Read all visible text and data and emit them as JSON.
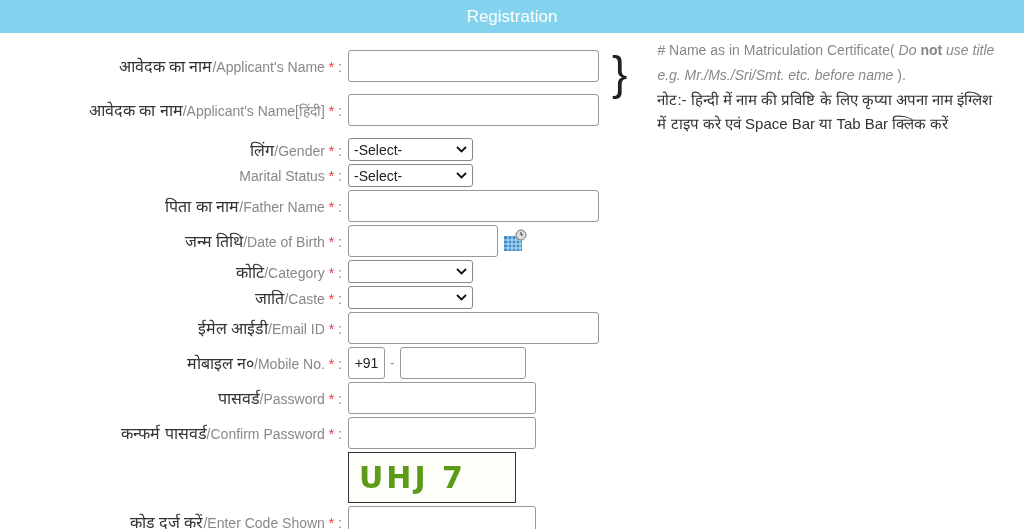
{
  "header": {
    "title": "Registration"
  },
  "fields": [
    {
      "kind": "name",
      "hindi": "आवेदक का नाम",
      "english": "/Applicant's Name",
      "asterisk": "*",
      "colon": ":"
    },
    {
      "kind": "name",
      "hindi": "आवेदक का नाम",
      "english": "/Applicant's Name[हिंदी]",
      "asterisk": "*",
      "colon": ":"
    },
    {
      "kind": "select",
      "hindi": "लिंग",
      "english": "/Gender",
      "asterisk": "*",
      "colon": ":",
      "value": "-Select-"
    },
    {
      "kind": "select",
      "english": "Marital Status",
      "asterisk": "*",
      "colon": ":",
      "value": "-Select-"
    },
    {
      "kind": "text",
      "hindi": "पिता का नाम",
      "english": "/Father Name",
      "asterisk": "*",
      "colon": ":"
    },
    {
      "kind": "date",
      "hindi": "जन्म तिथि",
      "english": "/Date of Birth",
      "asterisk": "*",
      "colon": ":"
    },
    {
      "kind": "select",
      "hindi": "कोटि",
      "english": "/Category",
      "asterisk": "*",
      "colon": ":"
    },
    {
      "kind": "select",
      "hindi": "जाति",
      "english": "/Caste",
      "asterisk": "*",
      "colon": ":"
    },
    {
      "kind": "text",
      "hindi": "ईमेल आईडी",
      "english": "/Email ID",
      "asterisk": "*",
      "colon": ":"
    },
    {
      "kind": "mobile",
      "hindi": "मोबाइल न०",
      "english": "/Mobile No.",
      "asterisk": "*",
      "colon": ":",
      "prefix": "+91",
      "separator": "-"
    },
    {
      "kind": "password",
      "hindi": "पासवर्ड",
      "english": "/Password",
      "asterisk": "*",
      "colon": ":"
    },
    {
      "kind": "password",
      "hindi": "कन्फर्म पासवर्ड",
      "english": "/Confirm Password",
      "asterisk": "*",
      "colon": ":"
    },
    {
      "kind": "captcha",
      "code": "UHJ 7"
    },
    {
      "kind": "password",
      "hindi": "कोड दर्ज करें",
      "english": "/Enter Code Shown",
      "asterisk": "*",
      "colon": ":"
    }
  ],
  "note": {
    "brace": "}",
    "english": "# Name as in Matriculation Certificate( *Do* **not** *use title e.g. Mr./Ms./Sri/Smt. etc. before name* ).",
    "hindi": "नोट:- हिन्दी में नाम की प्रविष्टि के लिए कृप्या अपना नाम इंग्लिश में टाइप करे एवं Space Bar या Tab Bar क्लिक करें"
  }
}
